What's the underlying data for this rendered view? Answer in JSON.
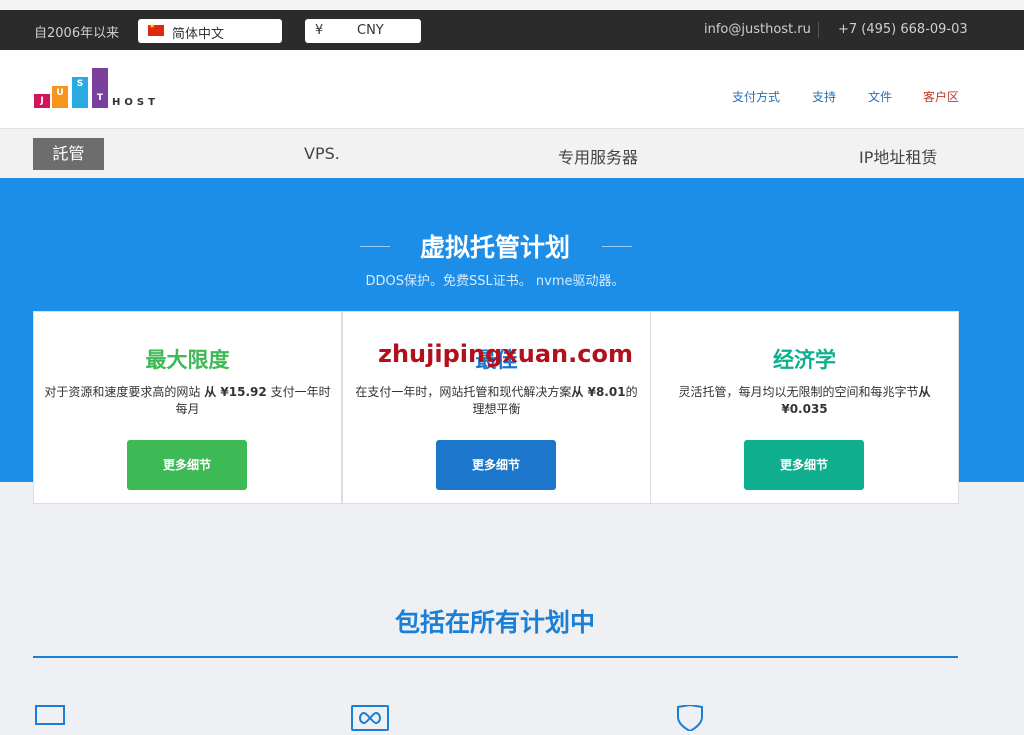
{
  "topbar": {
    "since": "自2006年以来",
    "language": "简体中文",
    "currency_symbol": "¥",
    "currency_code": "CNY",
    "email": "info@justhost.ru",
    "phone": "+7 (495) 668-09-03"
  },
  "logo": {
    "letters": [
      "J",
      "U",
      "S",
      "T"
    ],
    "host": "HOST"
  },
  "header_nav": [
    "支付方式",
    "支持",
    "文件",
    "客户区"
  ],
  "main_nav": {
    "active": "託管",
    "items": [
      "VPS.",
      "专用服务器",
      "IP地址租赁"
    ]
  },
  "hero": {
    "title": "虚拟托管计划",
    "subtitle": "DDOS保护。免费SSL证书。 nvme驱动器。"
  },
  "plans": [
    {
      "name": "最大限度",
      "desc_pre": "对于资源和速度要求高的网站 ",
      "price": "从 ¥15.92",
      "desc_post": " 支付一年时每月",
      "button": "更多细节",
      "color": "#3dba55"
    },
    {
      "name": "最佳",
      "desc_pre": "在支付一年时，网站托管和现代解决方案",
      "price": "从 ¥8.01",
      "desc_post": "的理想平衡",
      "button": "更多细节",
      "color": "#1b76cc"
    },
    {
      "name": "经济学",
      "desc_pre": "灵活托管，每月均以无限制的空间和每兆字节",
      "price": "从 ¥0.035",
      "desc_post": "",
      "button": "更多细节",
      "color": "#0fae8e"
    }
  ],
  "watermark": "zhujipingxuan.com",
  "included": {
    "title": "包括在所有计划中"
  },
  "colors": {
    "topbar_bg": "#2b2b2b",
    "hero_bg": "#1c8ee8",
    "accent": "#1a7fd6"
  }
}
